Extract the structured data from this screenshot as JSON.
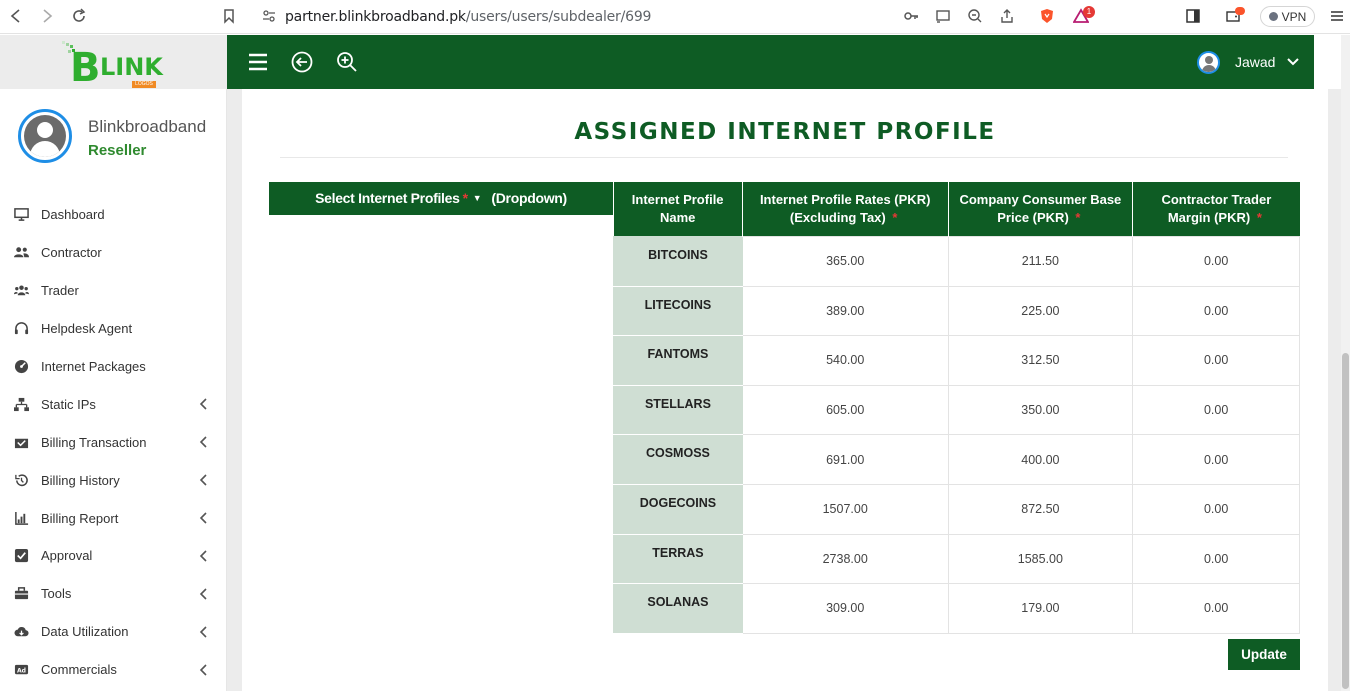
{
  "browser": {
    "url_host": "partner.blinkbroadband.pk",
    "url_path": "/users/users/subdealer/699",
    "notification_count": "1",
    "vpn_label": "VPN"
  },
  "sidebar": {
    "logo_text": "LINK",
    "logo_b": "B",
    "logo_tag": "LOGOS",
    "profile_name": "Blinkbroadband",
    "profile_role": "Reseller",
    "items": [
      {
        "label": "Dashboard",
        "icon": "monitor-icon",
        "has_submenu": false
      },
      {
        "label": "Contractor",
        "icon": "users-icon",
        "has_submenu": false
      },
      {
        "label": "Trader",
        "icon": "user-group-icon",
        "has_submenu": false
      },
      {
        "label": "Helpdesk Agent",
        "icon": "headset-icon",
        "has_submenu": false
      },
      {
        "label": "Internet Packages",
        "icon": "gauge-icon",
        "has_submenu": false
      },
      {
        "label": "Static IPs",
        "icon": "network-icon",
        "has_submenu": true
      },
      {
        "label": "Billing Transaction",
        "icon": "billing-icon",
        "has_submenu": true
      },
      {
        "label": "Billing History",
        "icon": "history-icon",
        "has_submenu": true
      },
      {
        "label": "Billing Report",
        "icon": "chart-icon",
        "has_submenu": true
      },
      {
        "label": "Approval",
        "icon": "check-square-icon",
        "has_submenu": true
      },
      {
        "label": "Tools",
        "icon": "toolbox-icon",
        "has_submenu": true
      },
      {
        "label": "Data Utilization",
        "icon": "cloud-download-icon",
        "has_submenu": true
      },
      {
        "label": "Commercials",
        "icon": "ad-icon",
        "has_submenu": true
      }
    ]
  },
  "header": {
    "user_name": "Jawad"
  },
  "main": {
    "title": "ASSIGNED INTERNET PROFILE",
    "dropdown_label": "Select Internet Profiles",
    "dropdown_required": "*",
    "dropdown_hint": "(Dropdown)",
    "update_label": "Update"
  },
  "table": {
    "headers": [
      {
        "label": "Internet Profile Name",
        "required": ""
      },
      {
        "label": "Internet Profile Rates (PKR) (Excluding Tax)",
        "required": "*"
      },
      {
        "label": "Company Consumer Base Price (PKR)",
        "required": "*"
      },
      {
        "label": "Contractor Trader Margin (PKR)",
        "required": "*"
      }
    ],
    "rows": [
      {
        "name": "BITCOINS",
        "rate": "365.00",
        "base": "211.50",
        "margin": "0.00"
      },
      {
        "name": "LITECOINS",
        "rate": "389.00",
        "base": "225.00",
        "margin": "0.00"
      },
      {
        "name": "FANTOMS",
        "rate": "540.00",
        "base": "312.50",
        "margin": "0.00"
      },
      {
        "name": "STELLARS",
        "rate": "605.00",
        "base": "350.00",
        "margin": "0.00"
      },
      {
        "name": "COSMOSS",
        "rate": "691.00",
        "base": "400.00",
        "margin": "0.00"
      },
      {
        "name": "DOGECOINS",
        "rate": "1507.00",
        "base": "872.50",
        "margin": "0.00"
      },
      {
        "name": "TERRAS",
        "rate": "2738.00",
        "base": "1585.00",
        "margin": "0.00"
      },
      {
        "name": "SOLANAS",
        "rate": "309.00",
        "base": "179.00",
        "margin": "0.00"
      }
    ]
  },
  "colors": {
    "brand_green": "#0e5c24",
    "name_cell_bg": "#cfded3",
    "required_red": "#e53935"
  }
}
